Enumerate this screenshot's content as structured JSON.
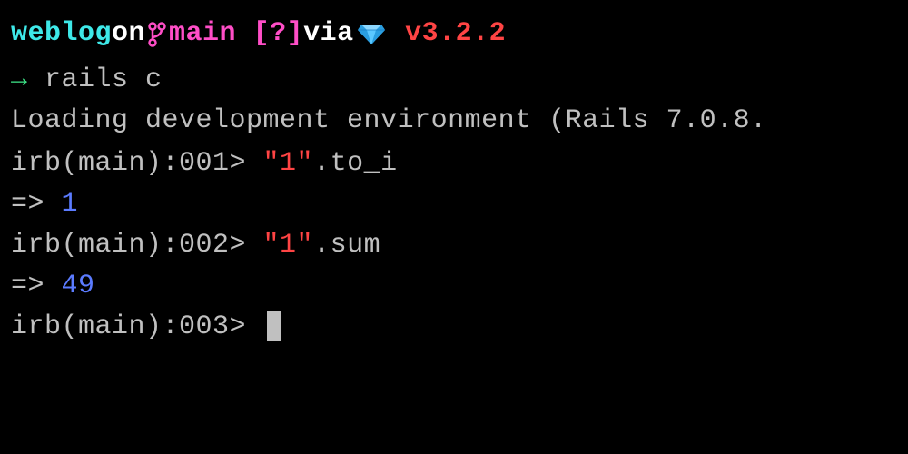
{
  "prompt": {
    "dir": "weblog",
    "on": " on ",
    "branch": "main",
    "status": "[?]",
    "via": " via ",
    "version": "v3.2.2"
  },
  "command": {
    "arrow": "→ ",
    "text": "rails c"
  },
  "lines": {
    "loading": "Loading development environment (Rails 7.0.8.",
    "irb1_prompt": "irb(main):001> ",
    "irb1_string": "\"1\"",
    "irb1_method": ".to_i",
    "result1_arrow": "=> ",
    "result1_value": "1",
    "irb2_prompt": "irb(main):002> ",
    "irb2_string": "\"1\"",
    "irb2_method": ".sum",
    "result2_arrow": "=> ",
    "result2_value": "49",
    "irb3_prompt": "irb(main):003> "
  }
}
